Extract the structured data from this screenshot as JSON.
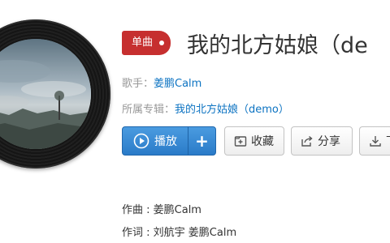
{
  "song": {
    "badge": "单曲",
    "title": "我的北方姑娘（de"
  },
  "artist": {
    "label": "歌手：",
    "name": "姜鹏Calm"
  },
  "album": {
    "label": "所属专辑：",
    "name": "我的北方姑娘（demo）"
  },
  "actions": {
    "play_label": "播放",
    "add_label": "+",
    "collect_label": "收藏",
    "share_label": "分享",
    "download_label": "下"
  },
  "credits": {
    "composer_label": "作曲 : ",
    "composer": "姜鹏Calm",
    "lyricist_label": "作词 : ",
    "lyricist": "刘航宇 姜鹏Calm"
  },
  "colors": {
    "badge": "#c62f2f",
    "link": "#0c73c2",
    "play_button": "#2a7bc8",
    "meta_text": "#999999"
  },
  "icons": {
    "play": "play-circle-icon",
    "collect": "folder-plus-icon",
    "share": "share-arrow-icon",
    "download": "download-icon"
  }
}
